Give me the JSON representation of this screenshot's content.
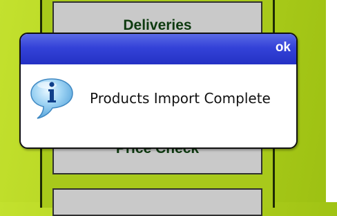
{
  "menu": {
    "items": [
      {
        "label": "Deliveries"
      },
      {
        "label": "Price Check"
      },
      {
        "label": ""
      }
    ]
  },
  "dialog": {
    "ok_label": "ok",
    "message": "Products Import Complete",
    "icon": "info-icon",
    "header_color": "#3342d8"
  },
  "colors": {
    "background": "#b3d21f",
    "menu_button": "#c9c9c9",
    "menu_text": "#0e3a10"
  }
}
